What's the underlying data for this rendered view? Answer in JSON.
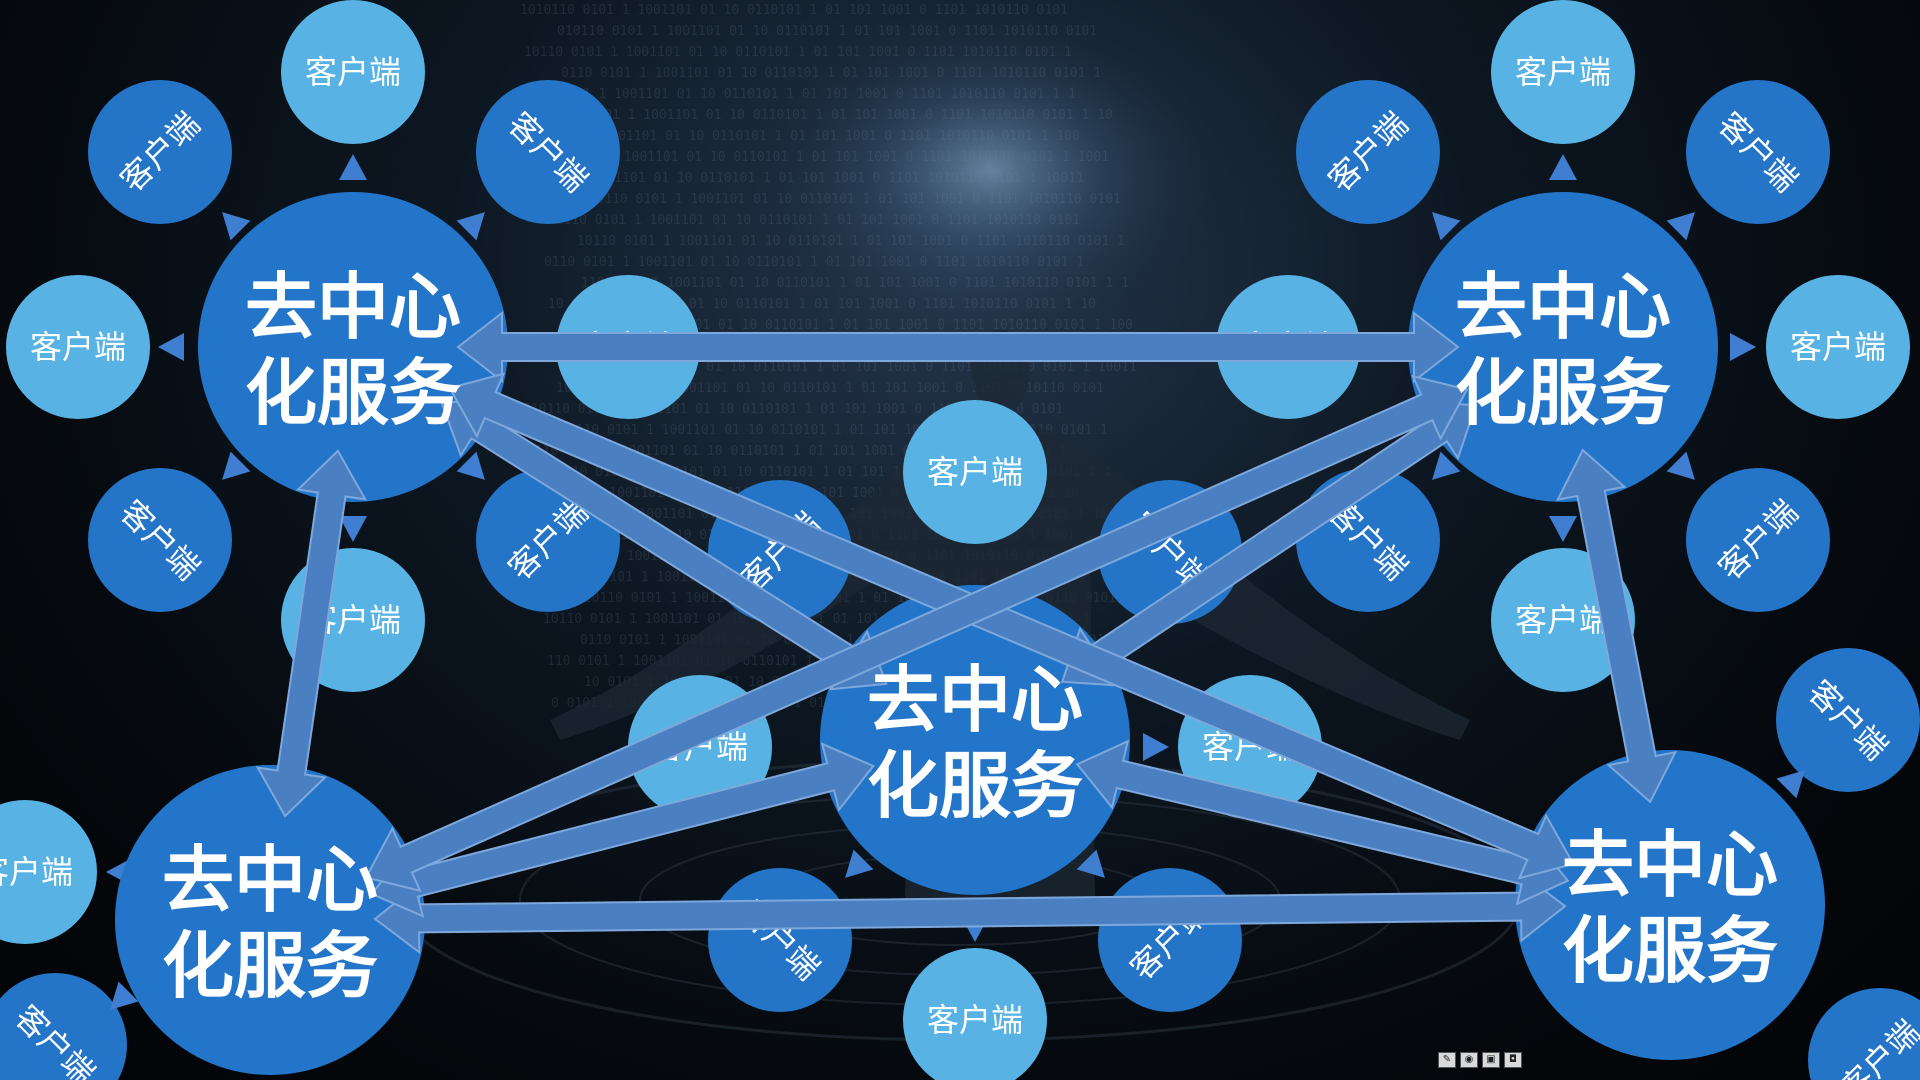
{
  "server_label": [
    "去中心",
    "化服务"
  ],
  "client_label": "客户端",
  "servers": [
    {
      "id": "server-top-left"
    },
    {
      "id": "server-top-right"
    },
    {
      "id": "server-center"
    },
    {
      "id": "server-bottom-left"
    },
    {
      "id": "server-bottom-right"
    }
  ],
  "links": [
    [
      "server-top-left",
      "server-top-right"
    ],
    [
      "server-top-left",
      "server-bottom-left"
    ],
    [
      "server-top-right",
      "server-bottom-right"
    ],
    [
      "server-bottom-left",
      "server-bottom-right"
    ],
    [
      "server-top-left",
      "server-center"
    ],
    [
      "server-top-right",
      "server-center"
    ],
    [
      "server-bottom-left",
      "server-center"
    ],
    [
      "server-bottom-right",
      "server-center"
    ],
    [
      "server-top-left",
      "server-bottom-right"
    ],
    [
      "server-top-right",
      "server-bottom-left"
    ]
  ],
  "colors": {
    "server": "#2275c9",
    "client_light": "#58b3e4",
    "client_dark": "#2474c7",
    "arrow": "#4a7fc1",
    "background": "#05080c"
  },
  "taskbar_icons": [
    "eraser-icon",
    "camera-icon",
    "save-icon",
    "lock-icon"
  ]
}
